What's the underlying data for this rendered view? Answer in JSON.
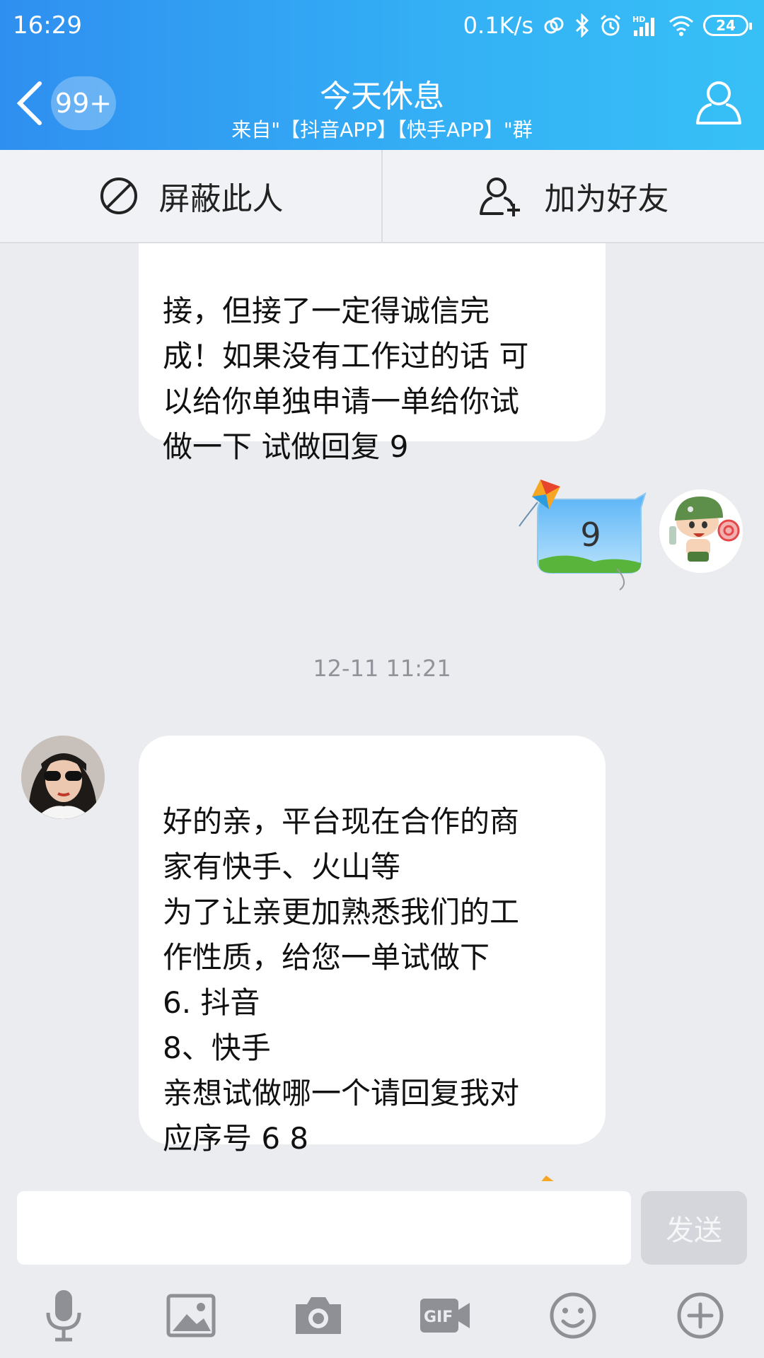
{
  "status_bar": {
    "time": "16:29",
    "network_speed": "0.1K/s",
    "battery": "24",
    "icons": [
      "sync-icon",
      "bluetooth-icon",
      "alarm-icon",
      "hd-signal-icon",
      "wifi-icon",
      "battery-icon"
    ]
  },
  "header": {
    "back_icon": "chevron-left-icon",
    "unread_badge": "99+",
    "title": "今天休息",
    "subtitle": "来自\"【抖音APP】【快手APP】\"群",
    "profile_icon": "person-icon"
  },
  "actions": {
    "block_label": "屏蔽此人",
    "block_icon": "block-icon",
    "add_friend_label": "加为好友",
    "add_friend_icon": "add-user-icon"
  },
  "chat": {
    "messages": [
      {
        "from": "other",
        "text": "接，但接了一定得诚信完\n成！如果没有工作过的话 可\n以给你单独申请一单给你试\n做一下  试做回复 9"
      },
      {
        "from": "self",
        "text": "9"
      },
      {
        "from": "timestamp",
        "text": "12-11 11:21"
      },
      {
        "from": "other",
        "text": "好的亲，平台现在合作的商\n家有快手、火山等\n为了让亲更加熟悉我们的工\n作性质，给您一单试做下\n6.  抖音\n8、快手\n亲想试做哪一个请回复我对\n应序号 6   8"
      }
    ]
  },
  "input": {
    "placeholder": "",
    "send_label": "发送"
  },
  "toolbar": {
    "icons": [
      "microphone-icon",
      "image-icon",
      "camera-icon",
      "gif-icon",
      "emoji-icon",
      "plus-icon"
    ]
  },
  "colors": {
    "header_start": "#2f8ff0",
    "header_end": "#37c0f6",
    "chat_background": "#ebecf0",
    "bubble": "#ffffff",
    "send_disabled": "#d4d6db"
  }
}
